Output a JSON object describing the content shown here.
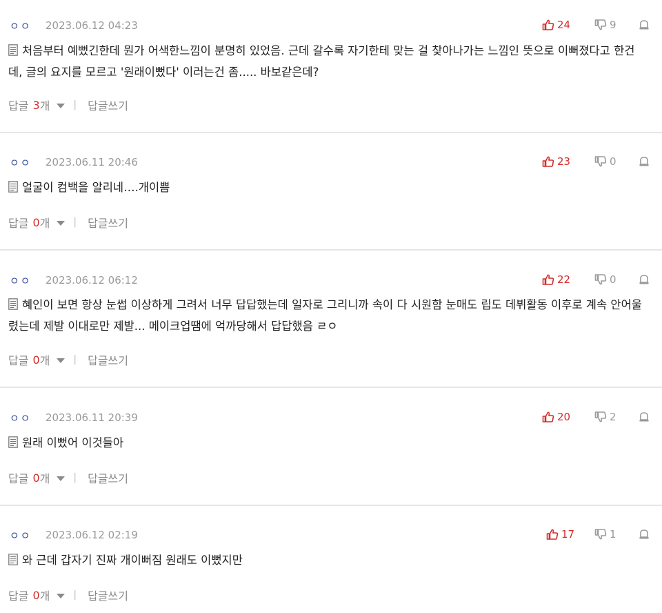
{
  "comments": [
    {
      "author": "ㅇㅇ",
      "date": "2023.06.12 04:23",
      "likes": "24",
      "dislikes": "9",
      "text": "처음부터 예뻤긴한데 뭔가 어색한느낌이 분명히 있었음. 근데 갈수록 자기한테 맞는 걸 찾아나가는 느낌인 뜻으로 이뻐졌다고 한건데, 글의 요지를 모르고 '원래이뻤다' 이러는건 좀..... 바보같은데?",
      "reply_label": "답글",
      "reply_count": "3",
      "reply_unit": "개",
      "write_reply": "답글쓰기"
    },
    {
      "author": "ㅇㅇ",
      "date": "2023.06.11 20:46",
      "likes": "23",
      "dislikes": "0",
      "text": "얼굴이 컴백을 알리네….개이쁨",
      "reply_label": "답글",
      "reply_count": "0",
      "reply_unit": "개",
      "write_reply": "답글쓰기"
    },
    {
      "author": "ㅇㅇ",
      "date": "2023.06.12 06:12",
      "likes": "22",
      "dislikes": "0",
      "text": "혜인이 보면 항상 눈썹 이상하게 그려서 너무 답답했는데 일자로 그리니까 속이 다 시원함 눈매도 립도 데뷔활동 이후로 계속 안어울렸는데 제발 이대로만 제발... 메이크업땜에 억까당해서 답답했음 ㄹㅇ",
      "reply_label": "답글",
      "reply_count": "0",
      "reply_unit": "개",
      "write_reply": "답글쓰기"
    },
    {
      "author": "ㅇㅇ",
      "date": "2023.06.11 20:39",
      "likes": "20",
      "dislikes": "2",
      "text": "원래 이뻤어 이것들아",
      "reply_label": "답글",
      "reply_count": "0",
      "reply_unit": "개",
      "write_reply": "답글쓰기"
    },
    {
      "author": "ㅇㅇ",
      "date": "2023.06.12 02:19",
      "likes": "17",
      "dislikes": "1",
      "text": "와 근데 갑자기 진짜 개이뻐짐 원래도 이뻤지만",
      "reply_label": "답글",
      "reply_count": "0",
      "reply_unit": "개",
      "write_reply": "답글쓰기"
    }
  ],
  "icons": {
    "like": "thumbs-up-icon",
    "dislike": "thumbs-down-icon",
    "report": "report-icon",
    "doc": "document-icon",
    "expand": "caret-down-icon"
  },
  "colors": {
    "author": "#3a4f9a",
    "like": "#d42b2b",
    "reply_count": "#d42b2b",
    "muted": "#9a9a9a",
    "divider": "#e6e6e6"
  }
}
